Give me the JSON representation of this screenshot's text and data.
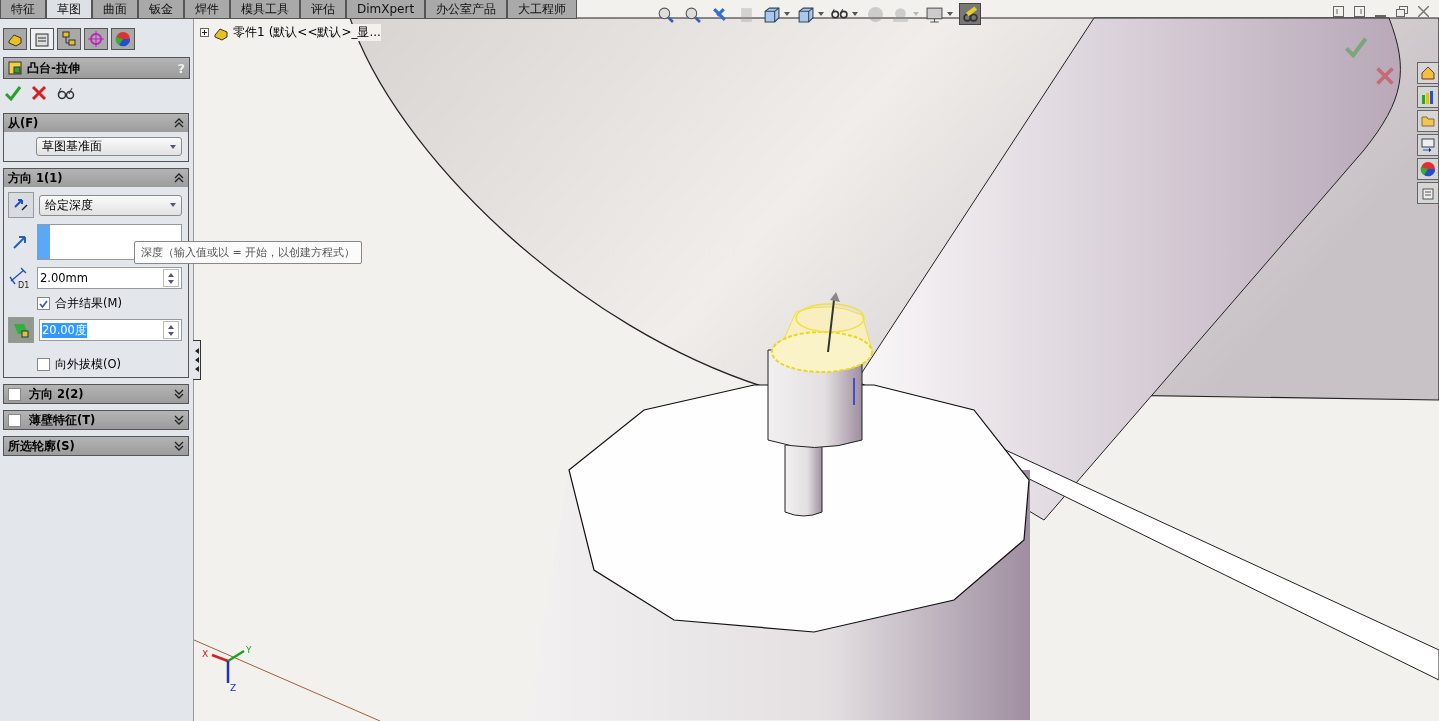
{
  "command_tabs": [
    {
      "label": "特征",
      "selected": false
    },
    {
      "label": "草图",
      "selected": true
    },
    {
      "label": "曲面",
      "selected": false
    },
    {
      "label": "钣金",
      "selected": false
    },
    {
      "label": "焊件",
      "selected": false
    },
    {
      "label": "模具工具",
      "selected": false
    },
    {
      "label": "评估",
      "selected": false
    },
    {
      "label": "DimXpert",
      "selected": false
    },
    {
      "label": "办公室产品",
      "selected": false
    },
    {
      "label": "大工程师",
      "selected": false
    }
  ],
  "panel_tabs": [
    {
      "kind": "feature",
      "selected": false
    },
    {
      "kind": "property",
      "selected": true
    },
    {
      "kind": "config",
      "selected": false
    },
    {
      "kind": "target",
      "selected": false
    },
    {
      "kind": "appearance",
      "selected": false
    }
  ],
  "feature": {
    "title": "凸台-拉伸",
    "help": "?"
  },
  "sections": [
    {
      "kind": "from",
      "title": "从(F)",
      "expanded": true,
      "select": "草图基准面"
    },
    {
      "kind": "direction",
      "title": "方向 1(1)",
      "expanded": true,
      "end_condition": "给定深度",
      "depth": "2.00mm",
      "dim_label": "D1",
      "merge": {
        "label": "合并结果(M)",
        "checked": true
      },
      "draft_angle": "20.00度",
      "draft_on": true,
      "draft_outward": {
        "label": "向外拔模(O)",
        "checked": false
      }
    },
    {
      "title": "方向 2(2)",
      "expanded": false,
      "checked": false
    },
    {
      "title": "薄壁特征(T)",
      "expanded": false,
      "checked": false
    },
    {
      "title": "所选轮廓(S)",
      "expanded": false
    }
  ],
  "tooltip": "深度（输入值或以 = 开始，以创建方程式）",
  "tree": {
    "label": "零件1",
    "config": "(默认<<默认>_显...",
    "expanded": false
  },
  "view_toolbar": [
    {
      "kind": "zoomfit",
      "dropdown": false,
      "disabled": false,
      "active": false
    },
    {
      "kind": "zoomarea",
      "dropdown": false,
      "disabled": false,
      "active": false
    },
    {
      "kind": "previous",
      "dropdown": false,
      "disabled": false,
      "active": false
    },
    {
      "kind": "section",
      "dropdown": false,
      "disabled": true,
      "active": false
    },
    {
      "kind": "orientation",
      "dropdown": true,
      "disabled": false,
      "active": false
    },
    {
      "kind": "display",
      "dropdown": true,
      "disabled": false,
      "active": false
    },
    {
      "kind": "hide",
      "dropdown": true,
      "disabled": false,
      "active": false
    },
    {
      "kind": "appearance",
      "dropdown": false,
      "disabled": true,
      "active": false
    },
    {
      "kind": "scene",
      "dropdown": true,
      "disabled": true,
      "active": false
    },
    {
      "kind": "settings",
      "dropdown": true,
      "disabled": false,
      "active": false
    },
    {
      "kind": "preview",
      "dropdown": false,
      "disabled": false,
      "active": true
    }
  ],
  "triad": [
    "X",
    "Y",
    "Z"
  ]
}
